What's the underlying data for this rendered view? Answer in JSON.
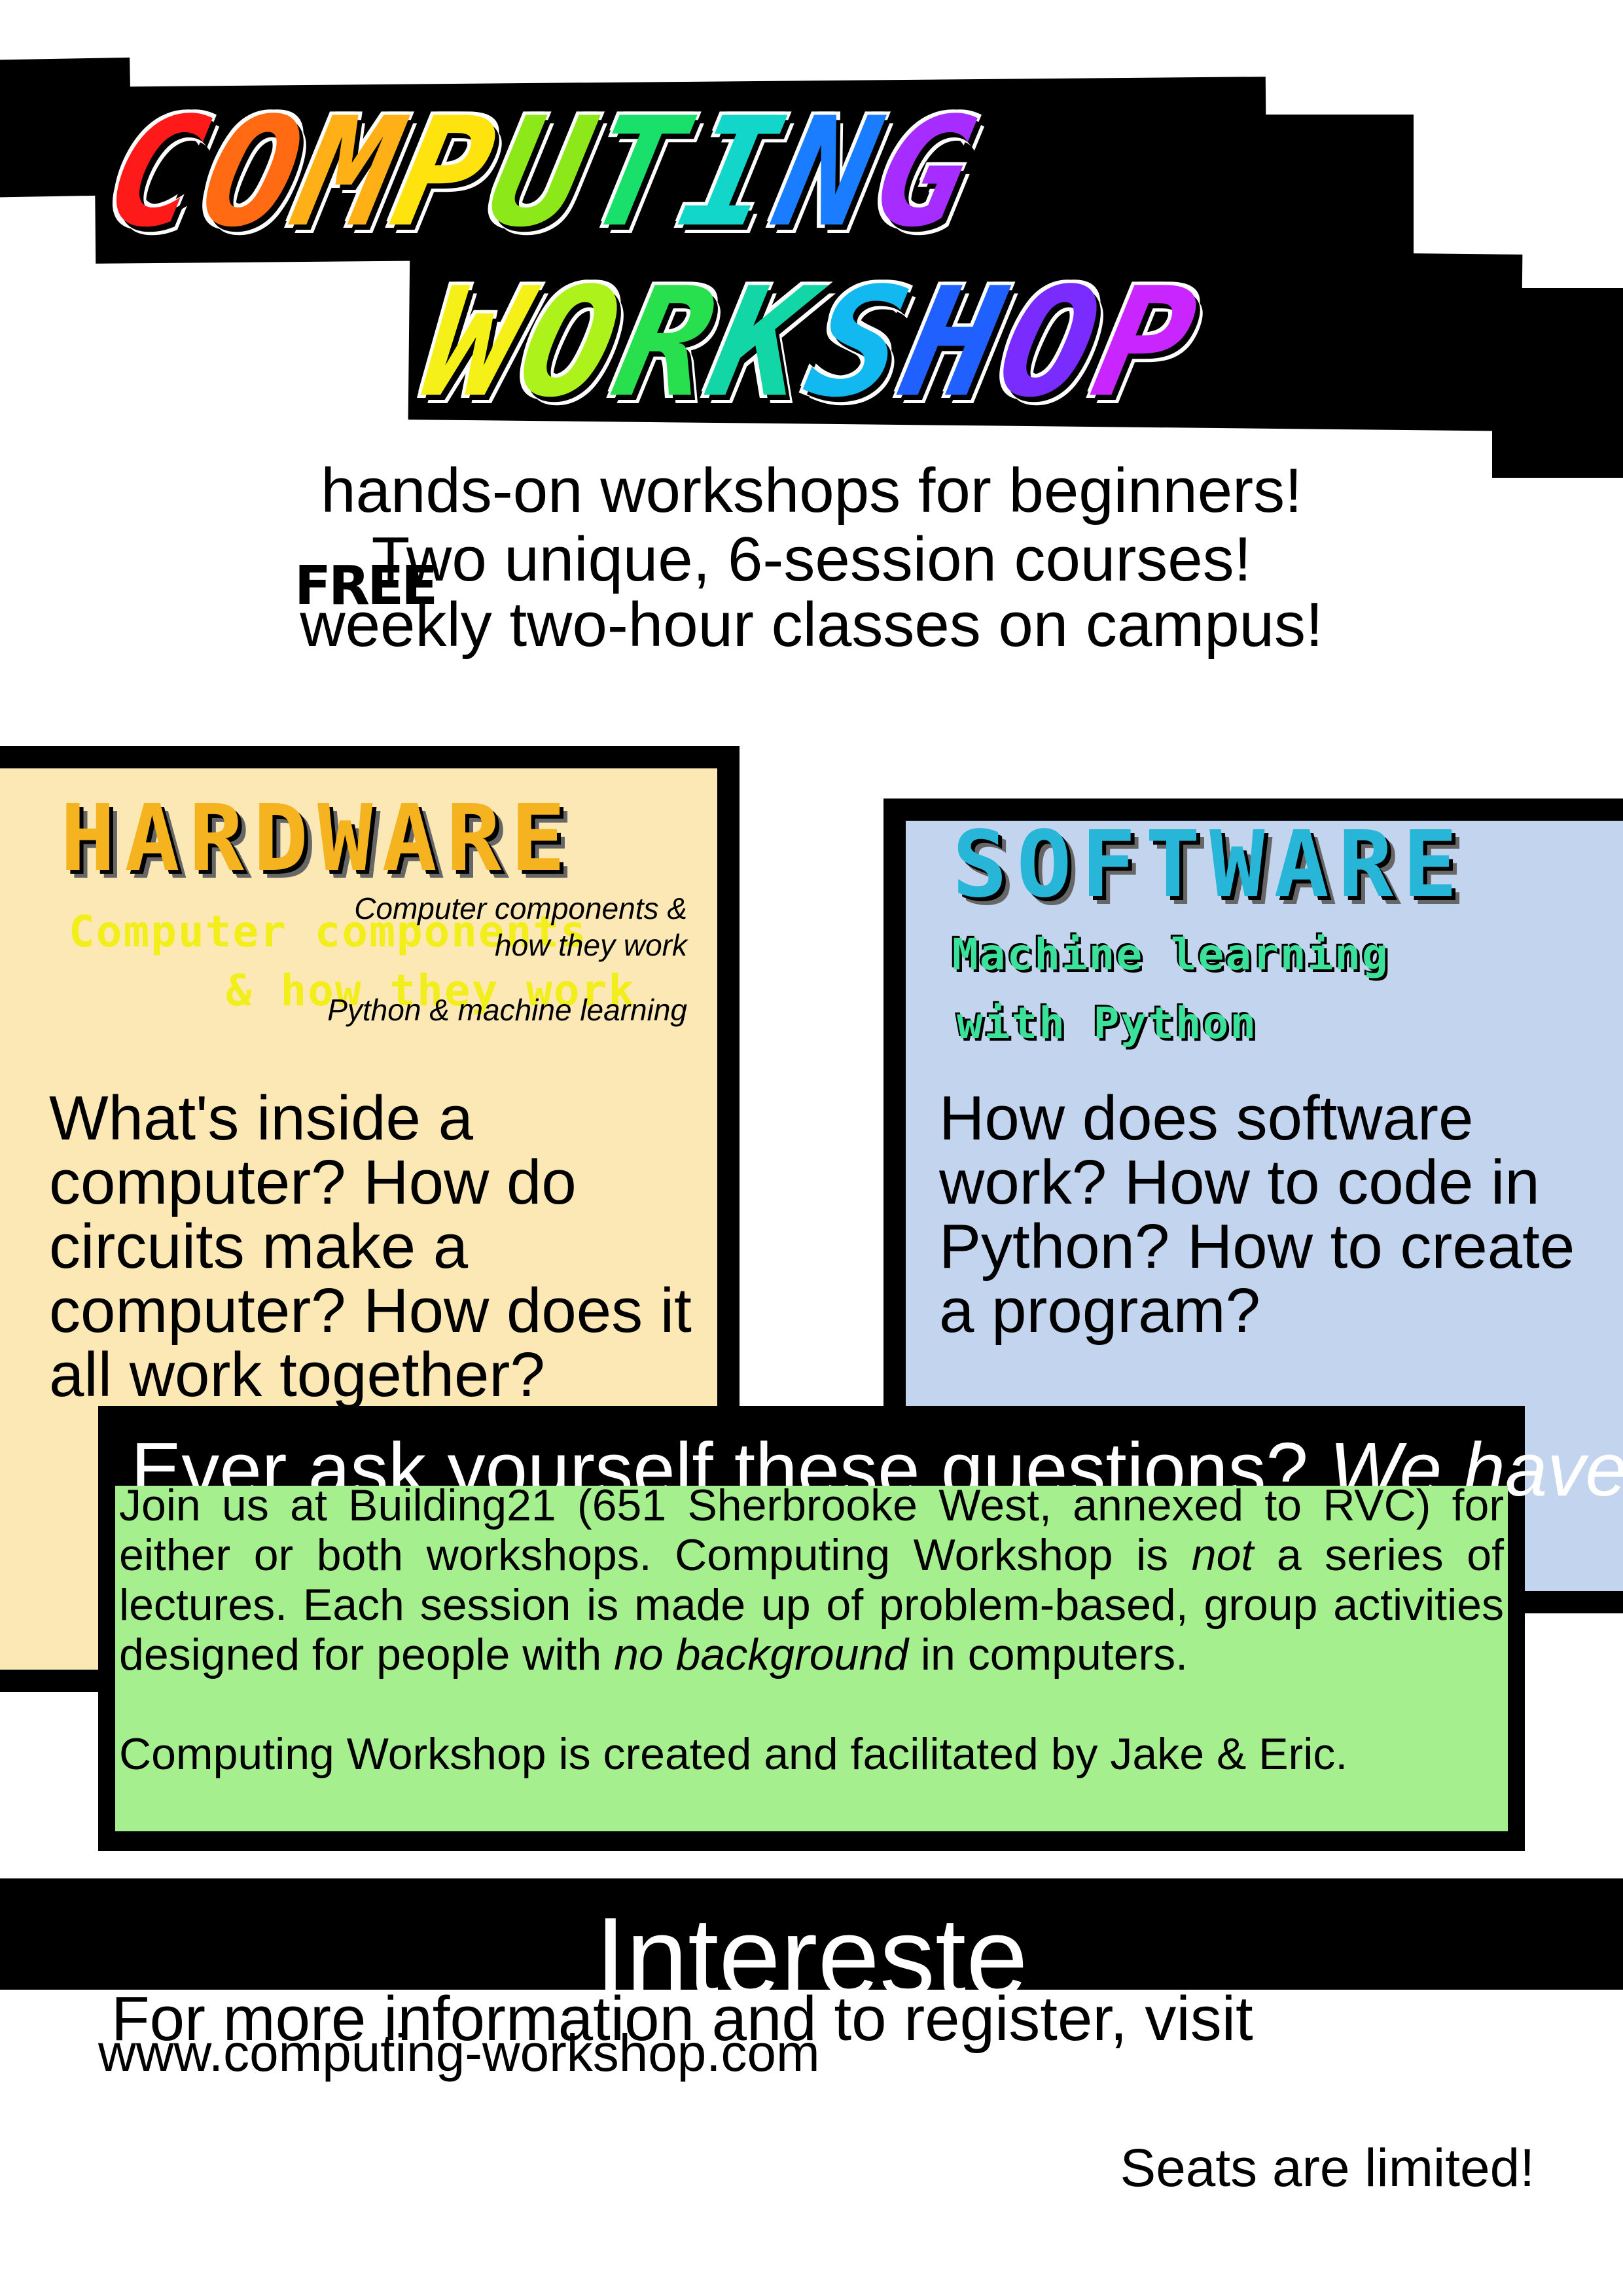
{
  "title": {
    "line1": [
      "C",
      "O",
      "M",
      "P",
      "U",
      "T",
      "I",
      "N",
      "G"
    ],
    "line2": [
      "W",
      "O",
      "R",
      "K",
      "S",
      "H",
      "O",
      "P"
    ],
    "line1_colors": [
      "#ff1a1a",
      "#ff6a13",
      "#ffb016",
      "#ffe30f",
      "#8de81a",
      "#19e06a",
      "#12d6c9",
      "#1a7dff",
      "#a62cff"
    ],
    "line2_colors": [
      "#f5f118",
      "#aef21c",
      "#28e04d",
      "#12d6a6",
      "#12b8f0",
      "#2060ff",
      "#7a2cff",
      "#c925ff",
      "#ff1fb8"
    ]
  },
  "intro": {
    "free": "FREE",
    "line1": "hands-on workshops for beginners!",
    "line2": "Two unique, 6-session courses!",
    "line3": "weekly two-hour classes on campus!"
  },
  "hardware": {
    "title": "HARDWARE",
    "sub1": "Computer components",
    "sub2": "& how they work",
    "italic1": "Computer components & how they work",
    "italic2": "Python & machine learning",
    "questions": "What's inside a computer? How do circuits make a computer? How does it all work together?"
  },
  "software": {
    "title": "SOFTWARE",
    "sub1": "Machine learning",
    "sub2": "with Python",
    "questions": "How does software work? How to code in Python? How to create a program?"
  },
  "join": {
    "heading": "Ever ask yourself these questions? ",
    "heading_italic": "We have answers!",
    "p1_a": "Join us at Building21 (651 Sherbrooke West, annexed to RVC) for either or both workshops. Computing Workshop is ",
    "p1_not": "not",
    "p1_b": " a series of lectures. Each session is made up of problem-based, group activities designed for people with ",
    "p1_nobg": "no background",
    "p1_c": " in computers.",
    "p2": "Computing Workshop is created and facilitated by Jake & Eric."
  },
  "footer": {
    "interested": "Intereste",
    "more": "For more information and to register, visit",
    "url": "www.computing-workshop.com",
    "seats": "Seats are limited!"
  }
}
